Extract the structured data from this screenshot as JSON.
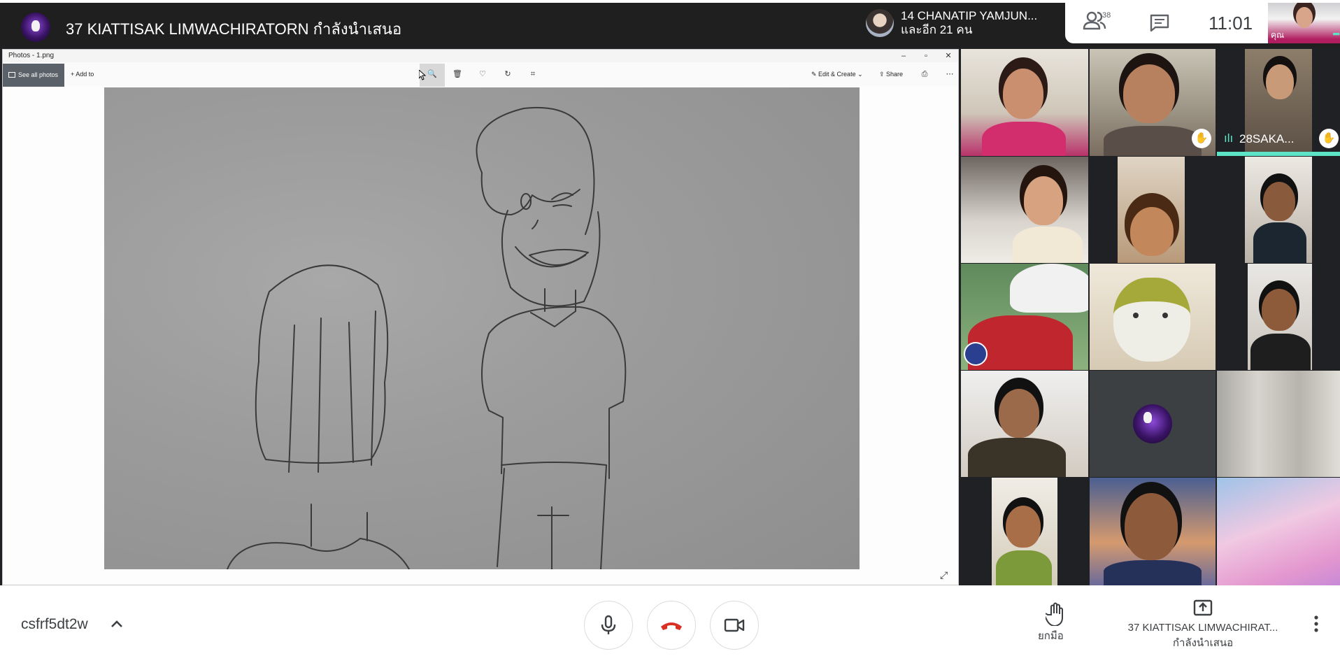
{
  "topbar": {
    "presenter_title": "37 KIATTISAK LIMWACHIRATORN กำลังนำเสนอ",
    "speaker_line1": "14 CHANATIP YAMJUN...",
    "speaker_line2": "และอีก 21 คน",
    "people_count": "38",
    "clock": "11:01",
    "self_label": "คุณ",
    "self_dots": "•••"
  },
  "shared_window": {
    "title": "Photos - 1.png",
    "see_all": "See all photos",
    "add_to": "Add to",
    "edit_create": "Edit & Create",
    "share": "Share"
  },
  "grid": {
    "tile3_name": "28SAKA..."
  },
  "bottom": {
    "meeting_code": "csfrf5dt2w",
    "raise_hand_label": "ยกมือ",
    "presenter_line1": "37 KIATTISAK LIMWACHIRAT...",
    "presenter_line2": "กำลังนำเสนอ"
  },
  "colors": {
    "hangup_red": "#d93025",
    "accent_teal": "#5de4c7",
    "topbar_bg": "#1f1f1f"
  },
  "icons": [
    "people-icon",
    "chat-icon",
    "mic-icon",
    "hangup-icon",
    "camera-icon",
    "hand-icon",
    "present-icon",
    "more-vert-icon",
    "chevron-up-icon",
    "expand-icon"
  ]
}
